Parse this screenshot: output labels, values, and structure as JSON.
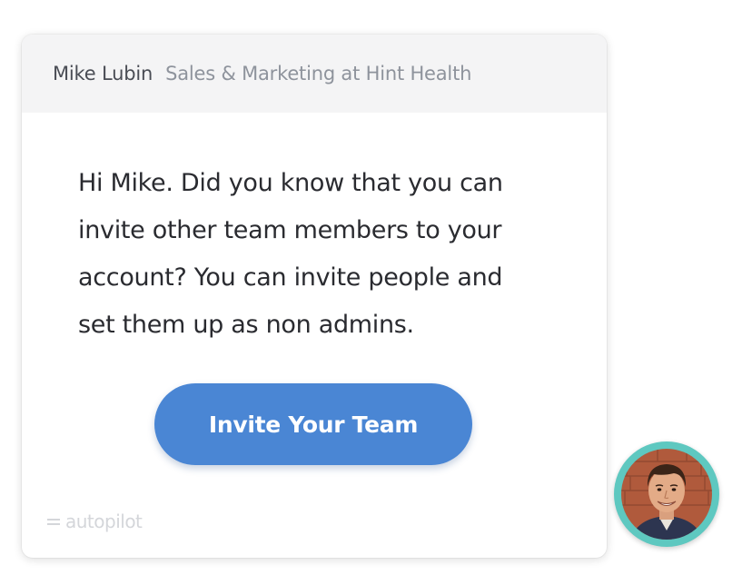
{
  "header": {
    "sender_name": "Mike Lubin",
    "sender_role": "Sales & Marketing at Hint Health"
  },
  "message": {
    "lines": [
      "Hi Mike. Did you know that you can",
      "invite other team members to your",
      "account? You can invite people and",
      "set them up as non admins."
    ]
  },
  "cta": {
    "label": "Invite Your Team",
    "color": "#4a86d4"
  },
  "footer": {
    "brand": "autopilot"
  },
  "avatar": {
    "ring_color": "#5ec8c0",
    "icon": "person-photo"
  }
}
